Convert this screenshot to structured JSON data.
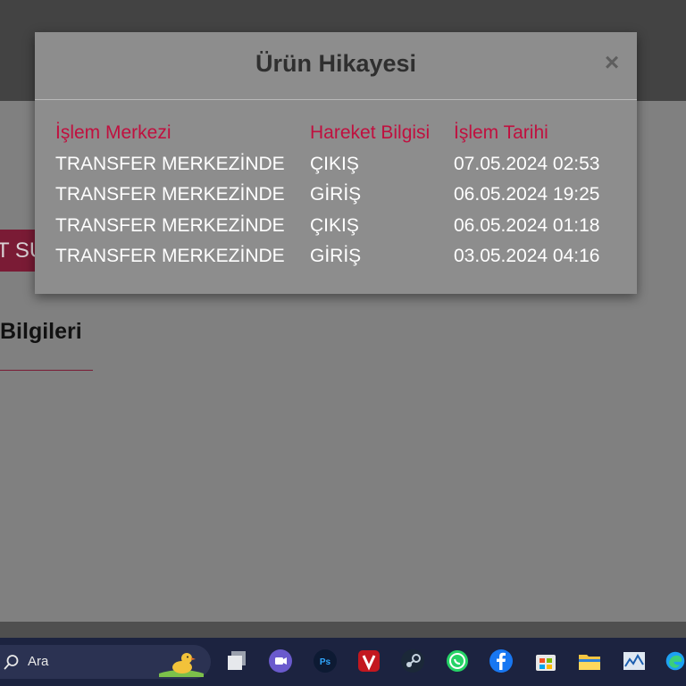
{
  "background": {
    "button_fragment": "T SU",
    "heading_fragment": "Bilgileri"
  },
  "modal": {
    "title": "Ürün Hikayesi",
    "close_glyph": "×",
    "columns": [
      "İşlem Merkezi",
      "Hareket Bilgisi",
      "İşlem Tarihi"
    ],
    "rows": [
      [
        "TRANSFER MERKEZİNDE",
        "ÇIKIŞ",
        "07.05.2024 02:53"
      ],
      [
        "TRANSFER MERKEZİNDE",
        "GİRİŞ",
        "06.05.2024 19:25"
      ],
      [
        "TRANSFER MERKEZİNDE",
        "ÇIKIŞ",
        "06.05.2024 01:18"
      ],
      [
        "TRANSFER MERKEZİNDE",
        "GİRİŞ",
        "03.05.2024 04:16"
      ]
    ]
  },
  "taskbar": {
    "search_placeholder": "Ara",
    "icons": [
      "task-view-icon",
      "teams-icon",
      "photoshop-icon",
      "vivaldi-icon",
      "steam-icon",
      "whatsapp-icon",
      "facebook-icon",
      "store-icon",
      "file-explorer-icon",
      "stock-chart-icon",
      "edge-icon"
    ]
  },
  "colors": {
    "accent": "#c0103f",
    "modal_bg": "#8d8d8d",
    "header_bg": "#434343",
    "taskbar_bg": "#1c2340"
  }
}
